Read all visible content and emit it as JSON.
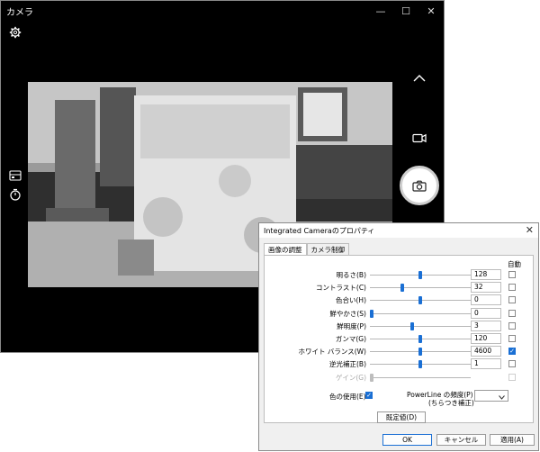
{
  "camera": {
    "title": "カメラ",
    "icons": [
      "gear-icon",
      "chevron-up-icon",
      "video-icon",
      "camera-icon",
      "hdr-icon",
      "timer-icon"
    ]
  },
  "window_controls": {
    "minimize": "—",
    "maximize": "☐",
    "close": "✕"
  },
  "dialog": {
    "title": "Integrated Cameraのプロパティ",
    "close": "✕",
    "tabs": [
      {
        "label": "画像の調整",
        "active": true
      },
      {
        "label": "カメラ制御",
        "active": false
      }
    ],
    "auto_header": "自動",
    "rows": [
      {
        "label": "明るさ(B)",
        "value": "128",
        "pos": 0.5,
        "auto": false,
        "enabled": true
      },
      {
        "label": "コントラスト(C)",
        "value": "32",
        "pos": 0.32,
        "auto": false,
        "enabled": true
      },
      {
        "label": "色合い(H)",
        "value": "0",
        "pos": 0.5,
        "auto": false,
        "enabled": true
      },
      {
        "label": "鮮やかさ(S)",
        "value": "0",
        "pos": 0.0,
        "auto": false,
        "enabled": true
      },
      {
        "label": "鮮明度(P)",
        "value": "3",
        "pos": 0.42,
        "auto": false,
        "enabled": true
      },
      {
        "label": "ガンマ(G)",
        "value": "120",
        "pos": 0.5,
        "auto": false,
        "enabled": true
      },
      {
        "label": "ホワイト バランス(W)",
        "value": "4600",
        "pos": 0.5,
        "auto": true,
        "enabled": true
      },
      {
        "label": "逆光補正(B)",
        "value": "1",
        "pos": 0.5,
        "auto": false,
        "enabled": true
      },
      {
        "label": "ゲイン(G)",
        "value": "",
        "pos": 0.0,
        "auto": false,
        "enabled": false
      }
    ],
    "color_enable_label": "色の使用(E)",
    "color_enable_checked": true,
    "powerline_label_1": "PowerLine の頻度(P)",
    "powerline_label_2": "(ちらつき補正)",
    "powerline_value": "",
    "default_button": "既定値(D)",
    "ok_button": "OK",
    "cancel_button": "キャンセル",
    "apply_button": "適用(A)"
  }
}
